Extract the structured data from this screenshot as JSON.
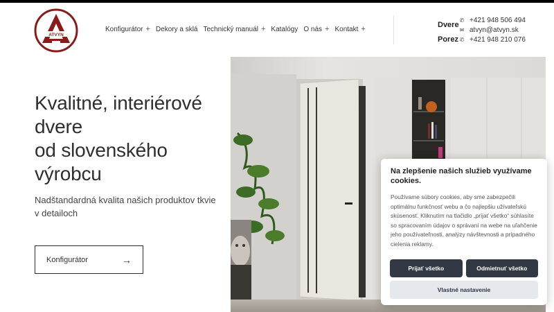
{
  "brand": {
    "logo_text": "ATVYN",
    "logo_color": "#8b1a1a"
  },
  "nav": {
    "items": [
      {
        "label": "Konfigurátor",
        "has_submenu": true
      },
      {
        "label": "Dekory a sklá",
        "has_submenu": false
      },
      {
        "label": "Technický manuál",
        "has_submenu": true
      },
      {
        "label": "Katalógy",
        "has_submenu": false
      },
      {
        "label": "O nás",
        "has_submenu": true
      },
      {
        "label": "Kontakt",
        "has_submenu": true
      }
    ],
    "submenu_glyph": "+"
  },
  "contact": {
    "doors_label": "Dvere",
    "doors_phone": "+421 948 506 494",
    "email": "atvyn@atvyn.sk",
    "frames_label": "Porez",
    "frames_phone": "+421 948 210 076"
  },
  "hero": {
    "title_lines": [
      "Kvalitné, interiérové",
      "dvere",
      "od slovenského",
      "výrobcu"
    ],
    "subtitle": "Nadštandardná kvalita našich produktov tkvie v detailoch",
    "cta_label": "Konfigurátor",
    "cta_arrow": "→"
  },
  "cookie": {
    "title": "Na zlepšenie našich služieb využívame cookies.",
    "text": "Používame súbory cookies, aby sme zabezpečili optimálnu funkčnosť webu a čo najlepšiu užívateľskú skúsenosť. Kliknutím na tlačidlo „prijať všetko“ súhlasíte so spracovaním údajov o správaní na webe na uľahčenie jeho používateľnosti, analýzy návštevnosti a prípadného cielenia reklamy.",
    "accept_all": "Prijať všetko",
    "reject_all": "Odmietnuť všetko",
    "custom": "Vlastné nastavenie"
  }
}
